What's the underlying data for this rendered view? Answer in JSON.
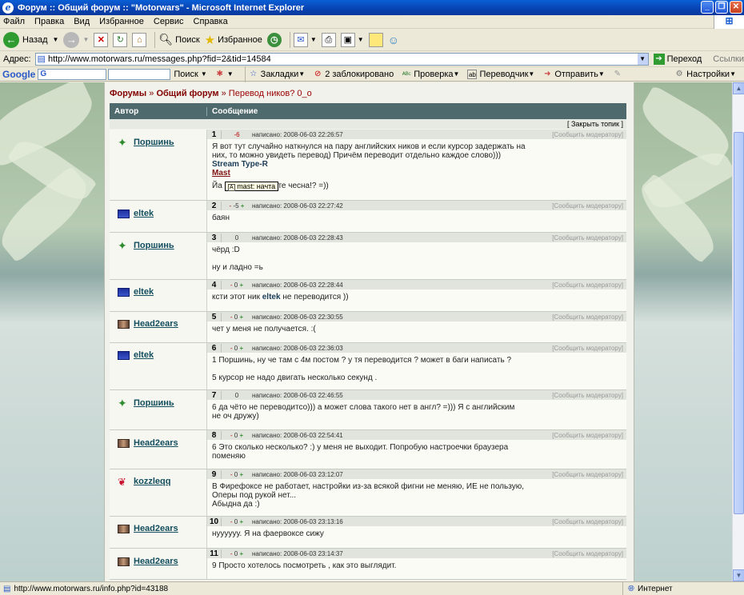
{
  "window": {
    "title": "Форум :: Общий форум :: \"Motorwars\" - Microsoft Internet Explorer"
  },
  "menu": [
    "Файл",
    "Правка",
    "Вид",
    "Избранное",
    "Сервис",
    "Справка"
  ],
  "toolbar": {
    "back": "Назад",
    "search": "Поиск",
    "favorites": "Избранное"
  },
  "address": {
    "label": "Адрес:",
    "url": "http://www.motorwars.ru/messages.php?fid=2&tid=14584",
    "go": "Переход",
    "links": "Ссылки"
  },
  "google": {
    "logo": "Google",
    "search": "Поиск",
    "bookmarks": "Закладки",
    "blocked": "2 заблокировано",
    "check": "Проверка",
    "translate": "Переводчик",
    "send": "Отправить",
    "settings": "Настройки"
  },
  "breadcrumb": {
    "forums": "Форумы",
    "sep": "»",
    "general": "Общий форум",
    "current": "Перевод ников? 0_о"
  },
  "table": {
    "col_author": "Автор",
    "col_message": "Сообщение",
    "close_topic": "[ Закрыть топик ]"
  },
  "report": "[Сообщить модератору]",
  "tooltip": "mast: начта",
  "posts": [
    {
      "num": "1",
      "rating": "-6",
      "rtype": "neg_only",
      "date": "написано: 2008-06-03 22:26:57",
      "author": "Поршинь",
      "avatar": "green",
      "lines": [
        "Я вот тут случайно наткнулся на пару английских ников и если курсор задержать на",
        "них, то можно увидеть перевод) Причём переводит отдельно каждое слово)))"
      ],
      "strong1": "Stream Type-R",
      "strong2": "Mast",
      "after": "Йа капитан скажите чесна!? =))"
    },
    {
      "num": "2",
      "rating": "-5",
      "rtype": "both",
      "date": "написано: 2008-06-03 22:27:42",
      "author": "eltek",
      "avatar": "blue",
      "paras": [
        "баян"
      ]
    },
    {
      "num": "3",
      "rating": "0",
      "rtype": "zero_only",
      "date": "написано: 2008-06-03 22:28:43",
      "author": "Поршинь",
      "avatar": "green",
      "paras": [
        "чёрд :D",
        "ну и ладно =ь"
      ]
    },
    {
      "num": "4",
      "rating": "0",
      "rtype": "both",
      "date": "написано: 2008-06-03 22:28:44",
      "author": "eltek",
      "avatar": "blue",
      "pre": "ксти этот ник ",
      "bold": "eltek",
      "post": " не переводится ))"
    },
    {
      "num": "5",
      "rating": "0",
      "rtype": "both",
      "date": "написано: 2008-06-03 22:30:55",
      "author": "Head2ears",
      "avatar": "cam",
      "paras": [
        "чет у меня не получается. :("
      ]
    },
    {
      "num": "6",
      "rating": "0",
      "rtype": "both",
      "date": "написано: 2008-06-03 22:36:03",
      "author": "eltek",
      "avatar": "blue",
      "paras": [
        "1 Поршинь, ну че там с 4м постом ? у тя переводится ? может в баги написать ?",
        "5 курсор не надо двигать несколько секунд ."
      ]
    },
    {
      "num": "7",
      "rating": "0",
      "rtype": "zero_only",
      "date": "написано: 2008-06-03 22:46:55",
      "author": "Поршинь",
      "avatar": "green",
      "paras": [
        "6 да чёто не переводитсо))) а может слова такого нет в англ? =))) Я с английским\nне оч дружу)"
      ]
    },
    {
      "num": "8",
      "rating": "0",
      "rtype": "both",
      "date": "написано: 2008-06-03 22:54:41",
      "author": "Head2ears",
      "avatar": "cam",
      "paras": [
        "6 Это сколько несколько? :) у меня не выходит. Попробую настроечки браузера\nпоменяю"
      ]
    },
    {
      "num": "9",
      "rating": "0",
      "rtype": "both",
      "date": "написано: 2008-06-03 23:12:07",
      "author": "kozzleqq",
      "avatar": "red",
      "paras": [
        "В Фирефоксе не работает, настройки из-за всякой фигни не меняю, ИЕ не пользую,\nОперы под рукой нет...\nАбыдна да :)"
      ]
    },
    {
      "num": "10",
      "rating": "0",
      "rtype": "both",
      "date": "написано: 2008-06-03 23:13:16",
      "author": "Head2ears",
      "avatar": "cam",
      "paras": [
        "нуууууу. Я на фаервоксе сижу"
      ]
    },
    {
      "num": "11",
      "rating": "0",
      "rtype": "both",
      "date": "написано: 2008-06-03 23:14:37",
      "author": "Head2ears",
      "avatar": "cam",
      "paras": [
        "9 Просто хотелось посмотреть , как это выглядит."
      ]
    }
  ],
  "status": {
    "url": "http://www.motorwars.ru/info.php?id=43188",
    "zone": "Интернет"
  }
}
